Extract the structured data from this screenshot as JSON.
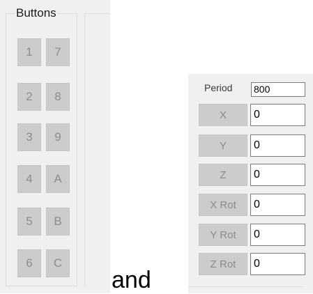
{
  "left_group": {
    "title": "Buttons",
    "buttons": [
      [
        "1",
        "7"
      ],
      [
        "2",
        "8"
      ],
      [
        "3",
        "9"
      ],
      [
        "4",
        "A"
      ],
      [
        "5",
        "B"
      ],
      [
        "6",
        "C"
      ]
    ]
  },
  "right_panel": {
    "period_label": "Period",
    "period_value": "800",
    "rows": [
      {
        "label": "X",
        "value": "0"
      },
      {
        "label": "Y",
        "value": "0"
      },
      {
        "label": "Z",
        "value": "0"
      },
      {
        "label": "X Rot",
        "value": "0"
      },
      {
        "label": "Y Rot",
        "value": "0"
      },
      {
        "label": "Z Rot",
        "value": "0"
      }
    ]
  },
  "caption": "and"
}
